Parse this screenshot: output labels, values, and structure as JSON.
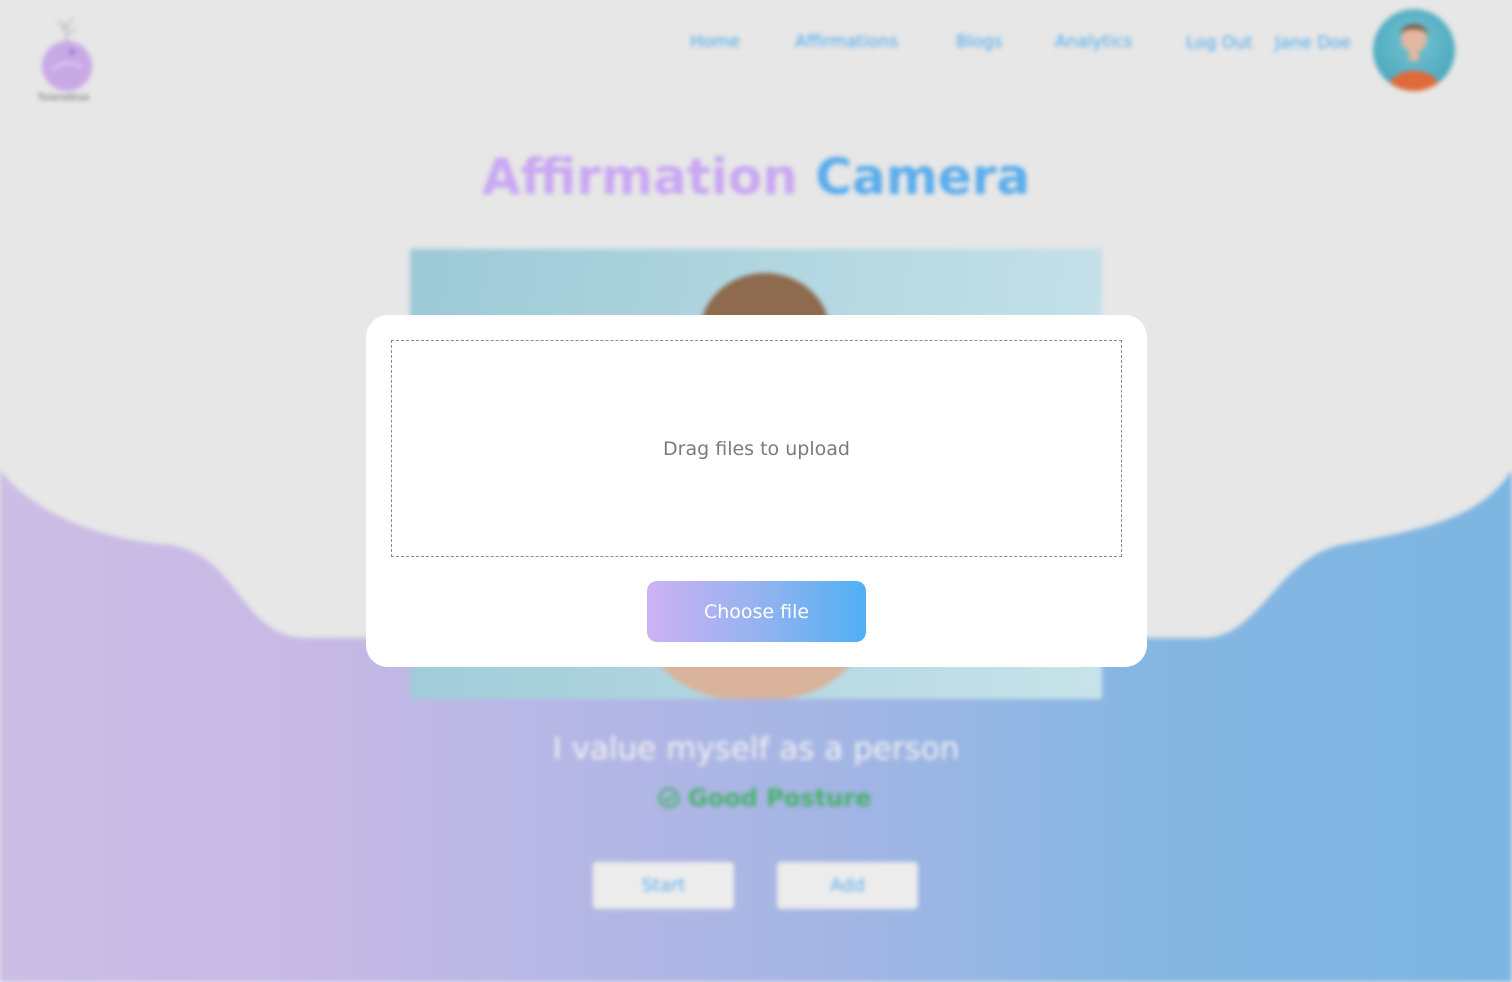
{
  "brand": {
    "logo_text": "Tulaneblue"
  },
  "nav": {
    "items": [
      {
        "label": "Home"
      },
      {
        "label": "Affirmations"
      },
      {
        "label": "Blogs"
      },
      {
        "label": "Analytics"
      }
    ],
    "logout_label": "Log Out",
    "user_name": "Jane Doe"
  },
  "page": {
    "title_part1": "Affirmation",
    "title_part2": "Camera",
    "affirmation": "I value myself as a person",
    "posture_status": "Good Posture",
    "start_label": "Start",
    "add_label": "Add"
  },
  "upload_modal": {
    "drop_text": "Drag files to upload",
    "choose_label": "Choose file"
  },
  "colors": {
    "accent_blue": "#5aacec",
    "accent_purple": "#c9a7f3",
    "success_green": "#45b06a"
  }
}
